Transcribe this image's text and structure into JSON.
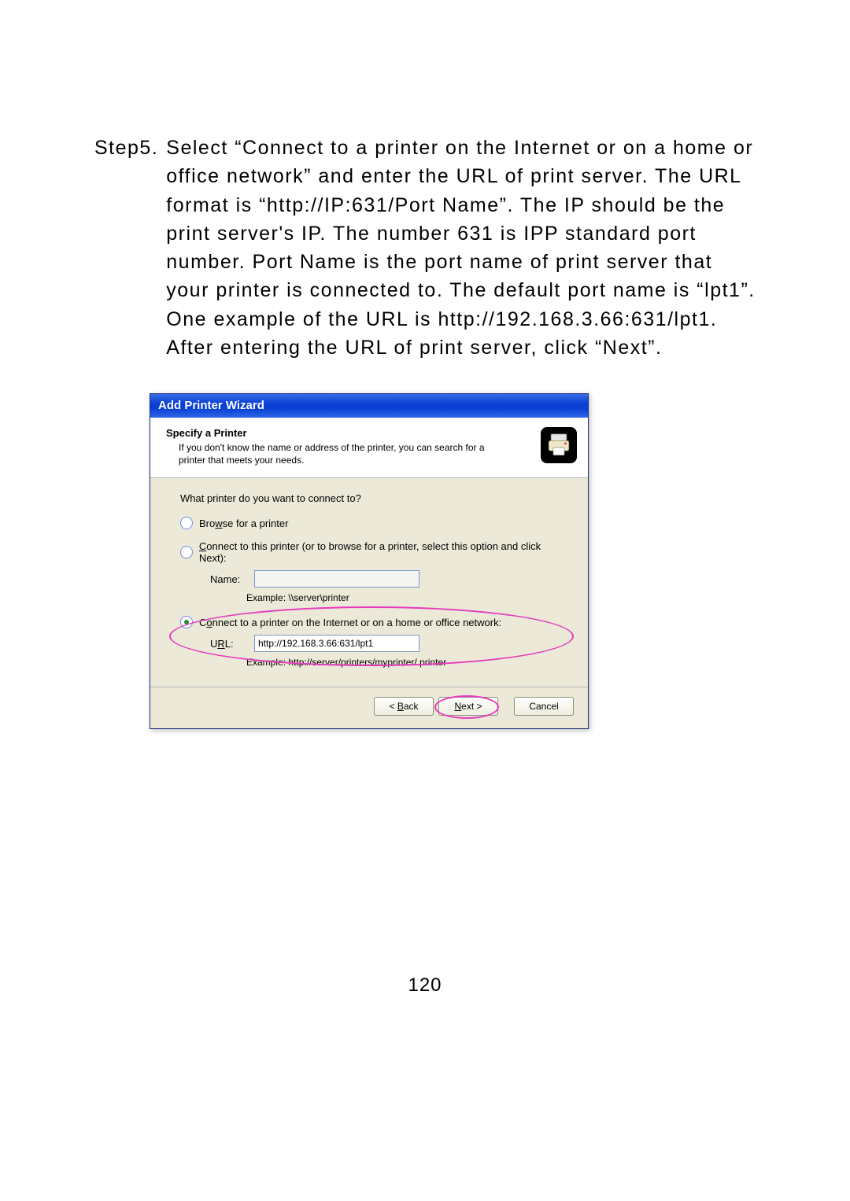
{
  "step": {
    "label": "Step5.",
    "body": "Select “Connect to a printer on the Internet or on a home or office network” and enter the URL of print server. The URL format is “http://IP:631/Port Name”. The IP should be the print server's IP. The number 631 is IPP standard port number. Port Name is the port name of print server that your printer is connected to. The default port name is “lpt1”. One example of the URL is http://192.168.3.66:631/lpt1. After entering the URL of print server, click “Next”."
  },
  "pageNumber": "120",
  "wizard": {
    "title": "Add Printer Wizard",
    "headerTitle": "Specify a Printer",
    "headerDesc": "If you don't know the name or address of the printer, you can search for a printer that meets your needs.",
    "question": "What printer do you want to connect to?",
    "opt1": {
      "pre": "Bro",
      "ak": "w",
      "post": "se for a printer"
    },
    "opt2": {
      "ak": "C",
      "post": "onnect to this printer (or to browse for a printer, select this option and click Next):"
    },
    "nameLabel": "Name:",
    "nameValue": "",
    "example1": "Example: \\\\server\\printer",
    "opt3": {
      "pre": "C",
      "ak": "o",
      "post": "nnect to a printer on the Internet or on a home or office network:"
    },
    "urlLabelPre": "U",
    "urlLabelAk": "R",
    "urlLabelPost": "L:",
    "urlValue": "http://192.168.3.66:631/lpt1",
    "example2": "Example: http://server/printers/myprinter/.printer",
    "buttons": {
      "back": {
        "pre": "< ",
        "ak": "B",
        "post": "ack"
      },
      "next": {
        "ak": "N",
        "post": "ext >"
      },
      "cancel": "Cancel"
    }
  }
}
